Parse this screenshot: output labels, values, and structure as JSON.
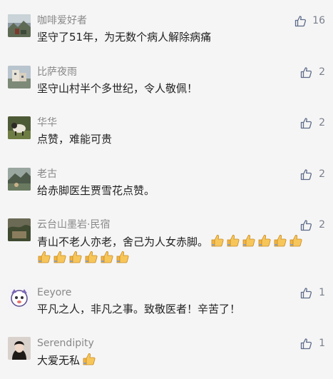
{
  "comments": [
    {
      "nickname": "咖啡爱好者",
      "content": "坚守了51年，为无数个病人解除病痛",
      "likes": "16",
      "avatar_icon": "landscape-avatar-icon",
      "emoji_count": 0
    },
    {
      "nickname": "比萨夜雨",
      "content": "坚守山村半个多世纪，令人敬佩！",
      "likes": "2",
      "avatar_icon": "building-avatar-icon",
      "emoji_count": 0
    },
    {
      "nickname": "华华",
      "content": "点赞，难能可贵",
      "likes": "2",
      "avatar_icon": "animal-avatar-icon",
      "emoji_count": 0
    },
    {
      "nickname": "老古",
      "content": "给赤脚医生贾雪花点赞。",
      "likes": "2",
      "avatar_icon": "mountain-avatar-icon",
      "emoji_count": 0
    },
    {
      "nickname": "云台山墨岩·民宿",
      "content": "青山不老人亦老，舍己为人女赤脚。",
      "likes": "2",
      "avatar_icon": "rock-avatar-icon",
      "emoji_count": 12
    },
    {
      "nickname": "Eeyore",
      "content": "平凡之人，非凡之事。致敬医者！辛苦了！",
      "likes": "1",
      "avatar_icon": "cartoon-face-avatar-icon",
      "emoji_count": 0
    },
    {
      "nickname": "Serendipity",
      "content": "大爱无私",
      "likes": "1",
      "avatar_icon": "portrait-avatar-icon",
      "emoji_count": 1
    }
  ],
  "icons": {
    "like": "thumbs-up-outline-icon",
    "emoji": "thumbs-up-emoji-icon"
  },
  "colors": {
    "background": "#f5f5f5",
    "nickname": "#888888",
    "content": "#222222",
    "like_icon": "#5d6b8a",
    "emoji_skin": "#f2b443"
  }
}
